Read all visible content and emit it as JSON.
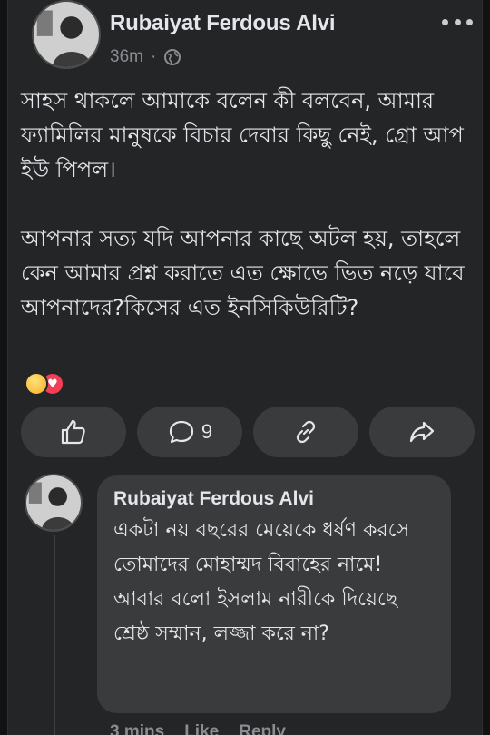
{
  "post": {
    "author": "Rubaiyat Ferdous Alvi",
    "time": "36m",
    "separator": "·",
    "privacy_icon": "globe-icon",
    "more_icon": "more-horizontal-icon",
    "paragraph_1": "সাহস থাকলে আমাকে বলেন কী বলবেন, আমার ফ্যামিলির মানুষকে বিচার দেবার কিছু নেই, গ্রো আপ ইউ পিপল।",
    "paragraph_2": "আপনার সত্য যদি আপনার কাছে অটল হয়, তাহলে কেন আমার প্রশ্ন করাতে এত ক্ষোভে ভিত নড়ে যাবে আপনাদের?কিসের এত ইনসিকিউরিটি?",
    "reactions": [
      "haha-reaction-icon",
      "love-reaction-icon"
    ]
  },
  "actions": {
    "like_icon": "thumbs-up-icon",
    "comment_icon": "comment-icon",
    "comment_count": "9",
    "share_link_icon": "link-icon",
    "share_icon": "share-arrow-icon"
  },
  "comment": {
    "author": "Rubaiyat Ferdous Alvi",
    "text": "একটা নয় বছরের মেয়েকে ধর্ষণ করসে তোমাদের মোহাম্মদ বিবাহের নামে! আবার বলো ইসলাম নারীকে দিয়েছে শ্রেষ্ঠ সম্মান, লজ্জা করে না?",
    "footer_time": "3 mins",
    "footer_like": "Like",
    "footer_reply": "Reply"
  },
  "colors": {
    "background": "#242526",
    "bubble": "#3a3b3c",
    "text": "#e4e6eb",
    "muted": "#8a8d91",
    "love": "#f33e58",
    "haha": "#f7b125"
  }
}
